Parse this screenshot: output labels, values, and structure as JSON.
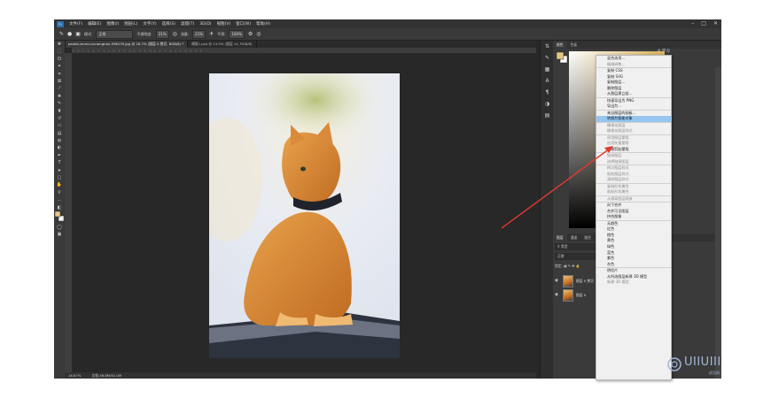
{
  "menubar": {
    "logo": "Ps",
    "items": [
      "文件(F)",
      "编辑(E)",
      "图像(I)",
      "图层(L)",
      "文字(Y)",
      "选择(S)",
      "滤镜(T)",
      "3D(D)",
      "视图(V)",
      "窗口(W)",
      "帮助(H)"
    ]
  },
  "options": {
    "mode_label": "模式:",
    "mode_value": "正常",
    "opacity_label": "不透明度:",
    "opacity_value": "21%",
    "flow_label": "流量:",
    "flow_value": "21%",
    "smooth_label": "平滑:",
    "smooth_value": "100%"
  },
  "doc_tabs": [
    "pexels-bruno-scramgnon-596135.jpg @ 16.7% (图层 0 拷贝, RGB/8) *",
    "模版1.psd @ 13.5% (图层 14, RGB/8)"
  ],
  "status": {
    "zoom": "16.67%",
    "doc": "文档:46.8M/92.0M"
  },
  "panels": {
    "color_tabs": [
      "颜色",
      "色板"
    ],
    "layer_tabs": [
      "图层",
      "通道",
      "路径"
    ],
    "search_type": "类型",
    "blend_mode": "正常",
    "lock_label": "锁定:",
    "layers": [
      {
        "name": "图层 0 拷贝"
      },
      {
        "name": "图层 0"
      }
    ],
    "help": "学习"
  },
  "context_menu": {
    "items": [
      {
        "label": "混合选项...",
        "state": "normal",
        "sep": false
      },
      {
        "label": "编辑调整...",
        "state": "disabled",
        "sep": false
      },
      {
        "label": "复制 CSS",
        "state": "normal",
        "sep": true
      },
      {
        "label": "复制 SVG",
        "state": "normal",
        "sep": false
      },
      {
        "label": "复制图层...",
        "state": "normal",
        "sep": false
      },
      {
        "label": "删除图层",
        "state": "normal",
        "sep": false
      },
      {
        "label": "从图层建立组...",
        "state": "normal",
        "sep": false
      },
      {
        "label": "快速导出为 PNG",
        "state": "normal",
        "sep": true
      },
      {
        "label": "导出为...",
        "state": "normal",
        "sep": false
      },
      {
        "label": "来自图层的画板...",
        "state": "normal",
        "sep": true
      },
      {
        "label": "转换为智能对象",
        "state": "highlight",
        "sep": false
      },
      {
        "label": "栅格化图层",
        "state": "disabled",
        "sep": true
      },
      {
        "label": "栅格化图层样式",
        "state": "disabled",
        "sep": false
      },
      {
        "label": "停用图层蒙版",
        "state": "disabled",
        "sep": true
      },
      {
        "label": "启用矢量蒙版",
        "state": "disabled",
        "sep": false
      },
      {
        "label": "创建剪贴蒙版",
        "state": "normal",
        "sep": false
      },
      {
        "label": "链接图层",
        "state": "disabled",
        "sep": true
      },
      {
        "label": "选择链接图层",
        "state": "disabled",
        "sep": false
      },
      {
        "label": "拷贝图层样式",
        "state": "disabled",
        "sep": true
      },
      {
        "label": "粘贴图层样式",
        "state": "disabled",
        "sep": false
      },
      {
        "label": "清除图层样式",
        "state": "disabled",
        "sep": false
      },
      {
        "label": "复制形状属性",
        "state": "disabled",
        "sep": true
      },
      {
        "label": "粘贴形状属性",
        "state": "disabled",
        "sep": false
      },
      {
        "label": "从隔离图层释放",
        "state": "disabled",
        "sep": true
      },
      {
        "label": "向下合并",
        "state": "normal",
        "sep": true
      },
      {
        "label": "合并可见图层",
        "state": "normal",
        "sep": false
      },
      {
        "label": "拼合图像",
        "state": "normal",
        "sep": false
      },
      {
        "label": "无颜色",
        "state": "normal",
        "sep": true
      },
      {
        "label": "红色",
        "state": "normal",
        "sep": false
      },
      {
        "label": "橙色",
        "state": "normal",
        "sep": false
      },
      {
        "label": "黄色",
        "state": "normal",
        "sep": false
      },
      {
        "label": "绿色",
        "state": "normal",
        "sep": false
      },
      {
        "label": "蓝色",
        "state": "normal",
        "sep": false
      },
      {
        "label": "紫色",
        "state": "normal",
        "sep": false
      },
      {
        "label": "灰色",
        "state": "normal",
        "sep": false
      },
      {
        "label": "明信片",
        "state": "normal",
        "sep": true
      },
      {
        "label": "从所选图层新建 3D 模型",
        "state": "normal",
        "sep": false
      },
      {
        "label": "新建 3D 模型",
        "state": "disabled",
        "sep": false
      }
    ]
  },
  "watermark": {
    "brand": "UIIUIII",
    "sub": "优设网"
  },
  "colors": {
    "highlight": "#96c6ef",
    "arrow": "#e03a2e",
    "app_bg": "#282828"
  }
}
